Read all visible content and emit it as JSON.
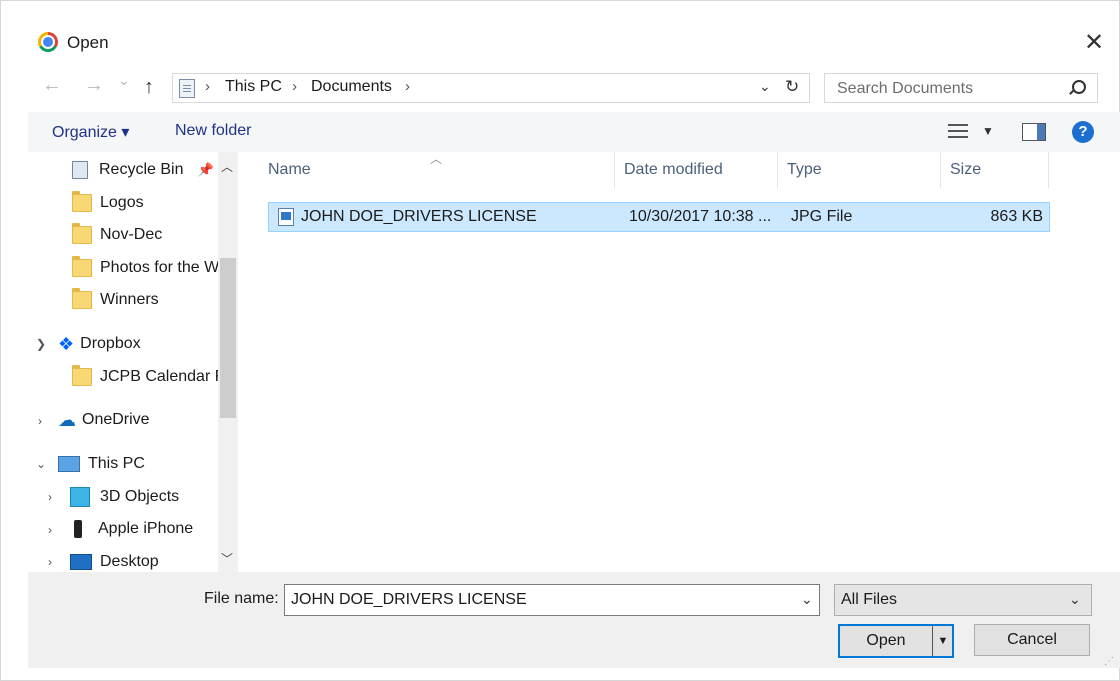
{
  "window": {
    "title": "Open"
  },
  "nav": {
    "back": "←",
    "forward": "→",
    "recent": "⌄",
    "up": "↑",
    "breadcrumbs": [
      "This PC",
      "Documents"
    ],
    "search_placeholder": "Search Documents"
  },
  "toolbar": {
    "organize": "Organize ▾",
    "new_folder": "New folder",
    "help": "?"
  },
  "sidebar": {
    "quick_access": [
      {
        "label": "Recycle Bin",
        "icon": "recycle-bin-icon",
        "pinned": true
      },
      {
        "label": "Logos",
        "icon": "folder-icon"
      },
      {
        "label": "Nov-Dec",
        "icon": "folder-icon"
      },
      {
        "label": "Photos for the W",
        "icon": "folder-icon"
      },
      {
        "label": "Winners",
        "icon": "folder-icon"
      }
    ],
    "dropbox": {
      "label": "Dropbox",
      "children": [
        "JCPB Calendar F"
      ]
    },
    "onedrive": {
      "label": "OneDrive"
    },
    "this_pc": {
      "label": "This PC",
      "children": [
        "3D Objects",
        "Apple iPhone",
        "Desktop"
      ]
    }
  },
  "columns": {
    "name": "Name",
    "date": "Date modified",
    "type": "Type",
    "size": "Size"
  },
  "files": [
    {
      "name": "JOHN DOE_DRIVERS LICENSE",
      "date": "10/30/2017 10:38 ...",
      "type": "JPG File",
      "size": "863 KB",
      "selected": true
    }
  ],
  "bottom": {
    "file_name_label": "File name:",
    "file_name_value": "JOHN DOE_DRIVERS LICENSE",
    "filter": "All Files",
    "open": "Open",
    "cancel": "Cancel"
  },
  "colors": {
    "accent": "#0078d7",
    "selection": "#cce8ff",
    "link": "#1e3287"
  }
}
